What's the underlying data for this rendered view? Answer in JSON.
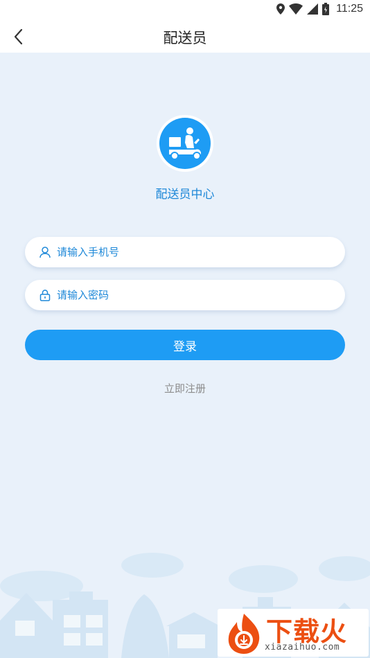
{
  "status_bar": {
    "time": "11:25",
    "icons": [
      "location-icon",
      "wifi-icon",
      "signal-icon",
      "battery-icon"
    ]
  },
  "app_bar": {
    "title": "配送员",
    "back_icon": "chevron-left-icon"
  },
  "brand": {
    "logo_icon": "delivery-scooter-icon",
    "title": "配送员中心",
    "accent_color": "#1e9cf4"
  },
  "form": {
    "phone": {
      "placeholder": "请输入手机号",
      "value": "",
      "icon": "user-icon"
    },
    "password": {
      "placeholder": "请输入密码",
      "value": "",
      "icon": "lock-icon"
    },
    "login_label": "登录",
    "register_label": "立即注册"
  },
  "watermark": {
    "brand": "下载火",
    "url": "xiazaihuo.com"
  }
}
